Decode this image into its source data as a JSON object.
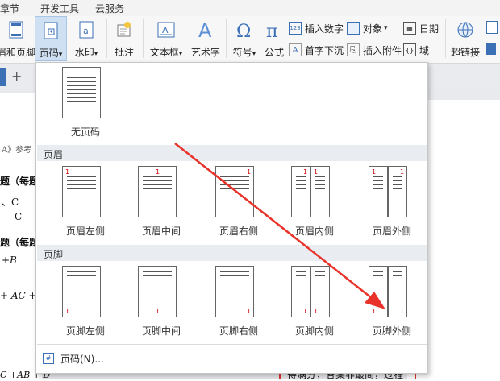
{
  "menubar": {
    "items": [
      "章节",
      "开发工具",
      "云服务"
    ]
  },
  "ribbon": {
    "header_footer_label": "眉和页脚",
    "page_number_label": "页码",
    "watermark_label": "水印",
    "comment_label": "批注",
    "textbox_label": "文本框",
    "wordart_label": "艺术字",
    "symbol_label": "符号",
    "formula_label": "公式",
    "insert_number_label": "插入数字",
    "object_label": "对象",
    "date_label": "日期",
    "dropcap_label": "首字下沉",
    "insert_attachment_label": "插入附件",
    "field_label": "域",
    "hyperlink_label": "超链接",
    "dropdown_arrow": "▾"
  },
  "tabs": {
    "add_label": "+"
  },
  "document": {
    "lines": [
      "A》参考",
      "题（每题",
      "、C",
      "C",
      "题（每题",
      "+B",
      "+ AC +",
      "C +AB + D",
      "得满分；答案非最简，过程"
    ]
  },
  "dropdown": {
    "none_label": "无页码",
    "header_section": "页眉",
    "footer_section": "页脚",
    "header_options": [
      "页眉左侧",
      "页眉中间",
      "页眉右侧",
      "页眉内侧",
      "页眉外侧"
    ],
    "footer_options": [
      "页脚左侧",
      "页脚中间",
      "页脚右侧",
      "页脚内侧",
      "页脚外侧"
    ],
    "page_number_dialog": "页码(N)...",
    "thumb_number": "1"
  },
  "colors": {
    "accent": "#2b6cb0",
    "highlight": "#cfe0f3",
    "page_number_red": "#cc0000",
    "arrow": "#e8322a"
  }
}
